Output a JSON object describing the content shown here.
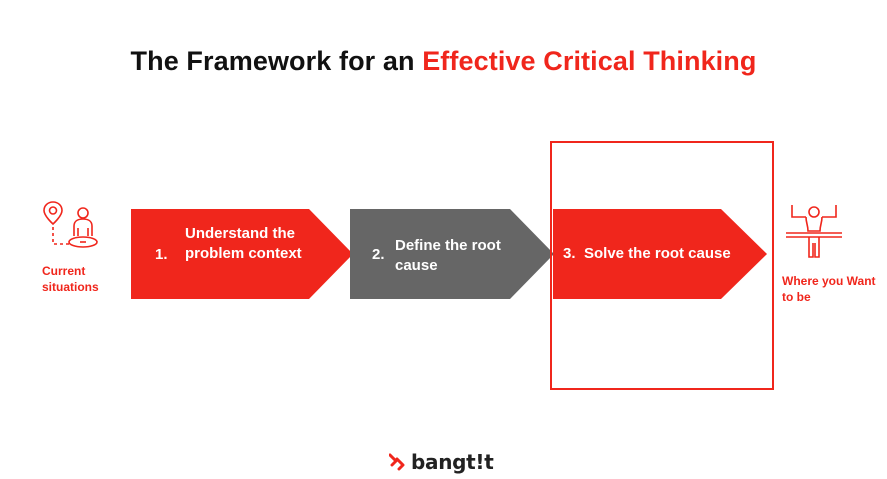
{
  "title": {
    "lead": "The Framework for an",
    "accent": "Effective Critical Thinking"
  },
  "start": {
    "label": "Current situations",
    "icon": "person-location-pin-icon"
  },
  "end": {
    "label": "Where you Want to be",
    "icon": "person-celebrating-finish-icon"
  },
  "steps": [
    {
      "number": "1.",
      "label": "Understand the problem context",
      "color": "#f0261c"
    },
    {
      "number": "2.",
      "label": "Define the root cause",
      "color": "#666666"
    },
    {
      "number": "3.",
      "label": "Solve the root cause",
      "color": "#f0261c"
    }
  ],
  "highlight_step": "3",
  "brand": {
    "name": "bangt!t",
    "logo_icon": "bangkit-chevrons-icon"
  },
  "colors": {
    "accent": "#f0261c",
    "gray": "#666666",
    "text": "#111111"
  }
}
